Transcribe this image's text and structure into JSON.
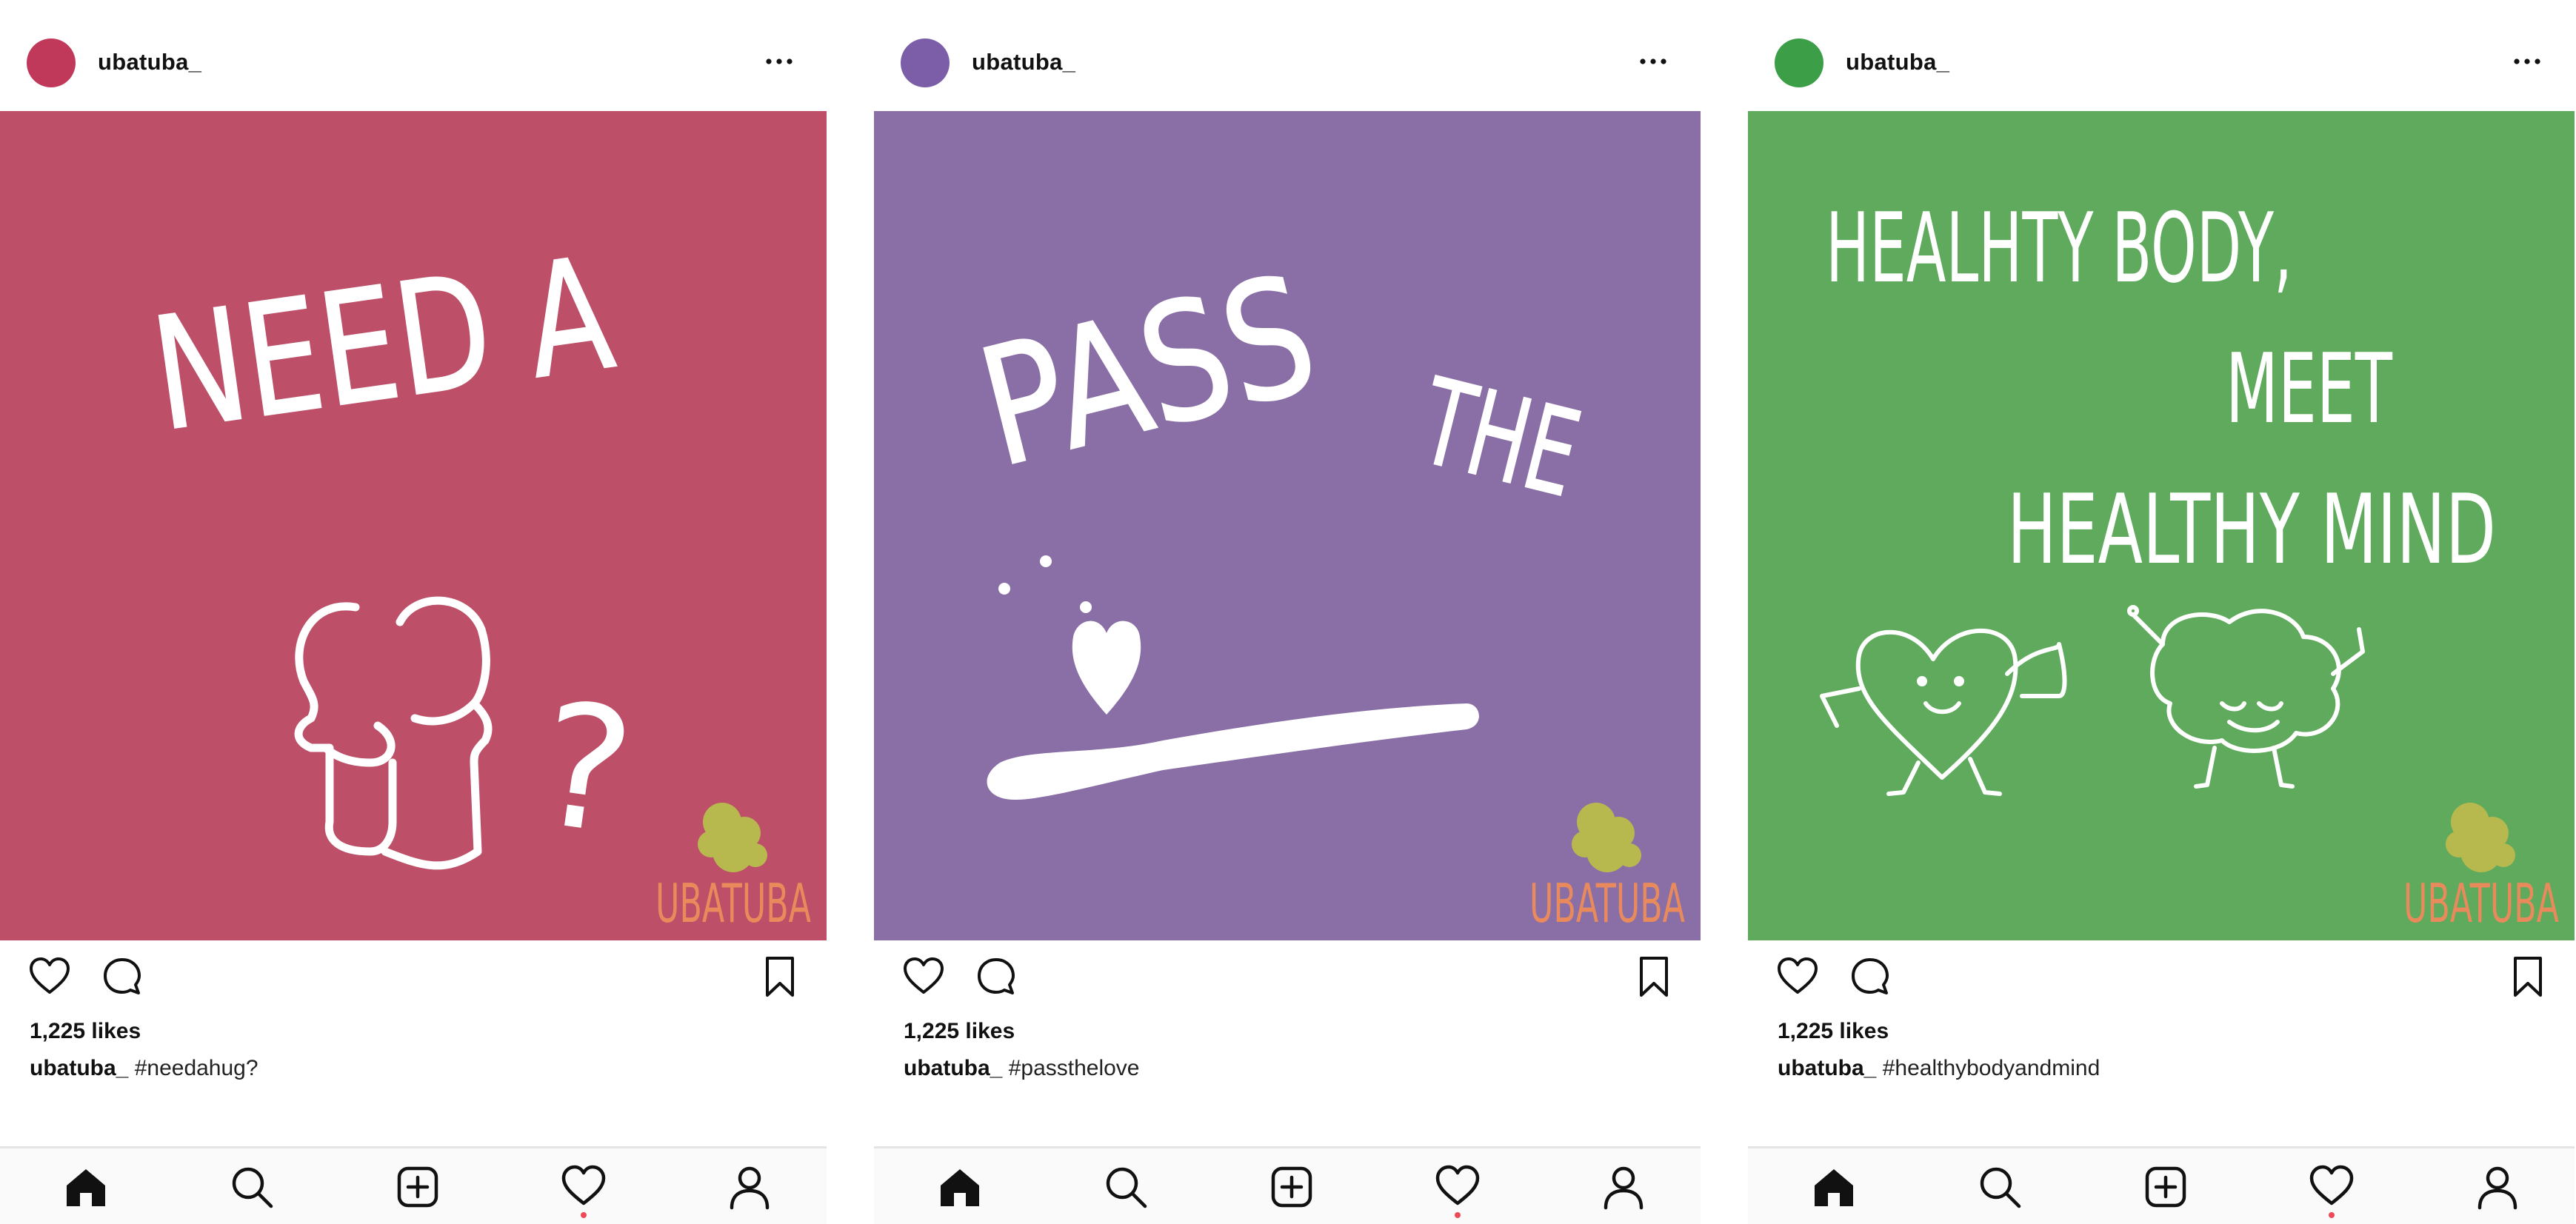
{
  "posts": [
    {
      "username": "ubatuba_",
      "avatar_color": "#c0395a",
      "bg_color": "#bd5068",
      "image_lines": [
        "NEED A",
        "?"
      ],
      "brand": "UBATUBA",
      "likes": "1,225 likes",
      "caption_user": "ubatuba_",
      "caption_text": "#needahug?"
    },
    {
      "username": "ubatuba_",
      "avatar_color": "#7b5ea7",
      "bg_color": "#8a6fa7",
      "image_lines": [
        "PASS",
        "THE"
      ],
      "brand": "UBATUBA",
      "likes": "1,225 likes",
      "caption_user": "ubatuba_",
      "caption_text": "#passthelove"
    },
    {
      "username": "ubatuba_",
      "avatar_color": "#3d9e48",
      "bg_color": "#5faa5d",
      "image_lines": [
        "HEALHTY BODY,",
        "MEET",
        "HEALTHY MIND"
      ],
      "brand": "UBATUBA",
      "likes": "1,225 likes",
      "caption_user": "ubatuba_",
      "caption_text": "#healthybodyandmind"
    }
  ],
  "icons": {
    "more": "more-options-icon",
    "like": "heart-icon",
    "comment": "comment-icon",
    "save": "bookmark-icon",
    "home": "home-icon",
    "search": "search-icon",
    "add": "add-post-icon",
    "activity": "activity-heart-icon",
    "profile": "profile-icon"
  },
  "colors": {
    "brand_orange": "#e98a5c",
    "logo_green": "#b7b94f",
    "notification_dot": "#ed4956",
    "text": "#111111"
  }
}
